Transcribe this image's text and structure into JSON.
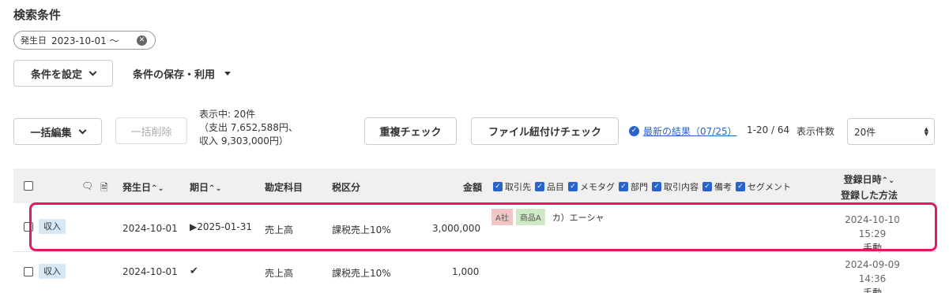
{
  "search": {
    "title": "検索条件",
    "chip_key": "発生日",
    "chip_value": "2023-10-01 〜",
    "set_conditions": "条件を設定",
    "save_use": "条件の保存・利用"
  },
  "toolbar": {
    "bulk_edit": "一括編集",
    "bulk_delete": "一括削除",
    "display_line1": "表示中: 20件",
    "display_line2": "（支出 7,652,588円、",
    "display_line3": "収入 9,303,000円）",
    "duplicate_check": "重複チェック",
    "file_link_check": "ファイル紐付けチェック",
    "latest_result": "最新の結果（07/25）",
    "range": "1-20 / 64",
    "count_label": "表示件数",
    "count_value": "20件"
  },
  "table": {
    "headers": {
      "date": "発生日",
      "due": "期日",
      "account": "勘定科目",
      "tax": "税区分",
      "amount": "金額",
      "reg1": "登録日時",
      "reg2": "登録した方法"
    },
    "filters": [
      "取引先",
      "品目",
      "メモタグ",
      "部門",
      "取引内容",
      "備考",
      "セグメント"
    ],
    "rows": [
      {
        "type": "収入",
        "date": "2024-10-01",
        "due": "▶2025-01-31",
        "account": "売上高",
        "tax": "課税売上10%",
        "amount": "3,000,000",
        "partner_tag": "A社",
        "item_tag": "商品A",
        "desc": "カ）エーシャ",
        "reg_time": "2024-10-10 15:29",
        "reg_method": "手動"
      },
      {
        "type": "収入",
        "date": "2024-10-01",
        "due": "✔",
        "account": "売上高",
        "tax": "課税売上10%",
        "amount": "1,000",
        "reg_time": "2024-09-09 14:36",
        "reg_method": "手動"
      }
    ]
  },
  "colors": {
    "accent": "#2a64c8",
    "highlight": "#e5195f",
    "income_tag": "#d6e8f5"
  }
}
